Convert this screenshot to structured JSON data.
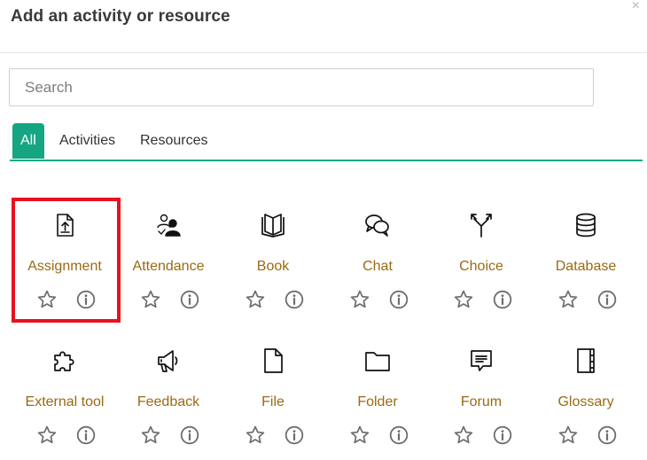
{
  "dialog": {
    "title": "Add an activity or resource",
    "close_symbol": "×"
  },
  "search": {
    "placeholder": "Search",
    "value": ""
  },
  "tabs": [
    {
      "label": "All",
      "active": true
    },
    {
      "label": "Activities",
      "active": false
    },
    {
      "label": "Resources",
      "active": false
    }
  ],
  "items": [
    {
      "label": "Assignment",
      "icon": "assignment-icon",
      "highlighted": true
    },
    {
      "label": "Attendance",
      "icon": "attendance-icon"
    },
    {
      "label": "Book",
      "icon": "book-icon"
    },
    {
      "label": "Chat",
      "icon": "chat-icon"
    },
    {
      "label": "Choice",
      "icon": "choice-icon"
    },
    {
      "label": "Database",
      "icon": "database-icon"
    },
    {
      "label": "External tool",
      "icon": "puzzle-icon"
    },
    {
      "label": "Feedback",
      "icon": "megaphone-icon"
    },
    {
      "label": "File",
      "icon": "file-icon"
    },
    {
      "label": "Folder",
      "icon": "folder-icon"
    },
    {
      "label": "Forum",
      "icon": "forum-icon"
    },
    {
      "label": "Glossary",
      "icon": "glossary-icon"
    }
  ],
  "colors": {
    "accent": "#16a582",
    "item_label": "#9a6a12",
    "highlight": "#e8121e"
  }
}
